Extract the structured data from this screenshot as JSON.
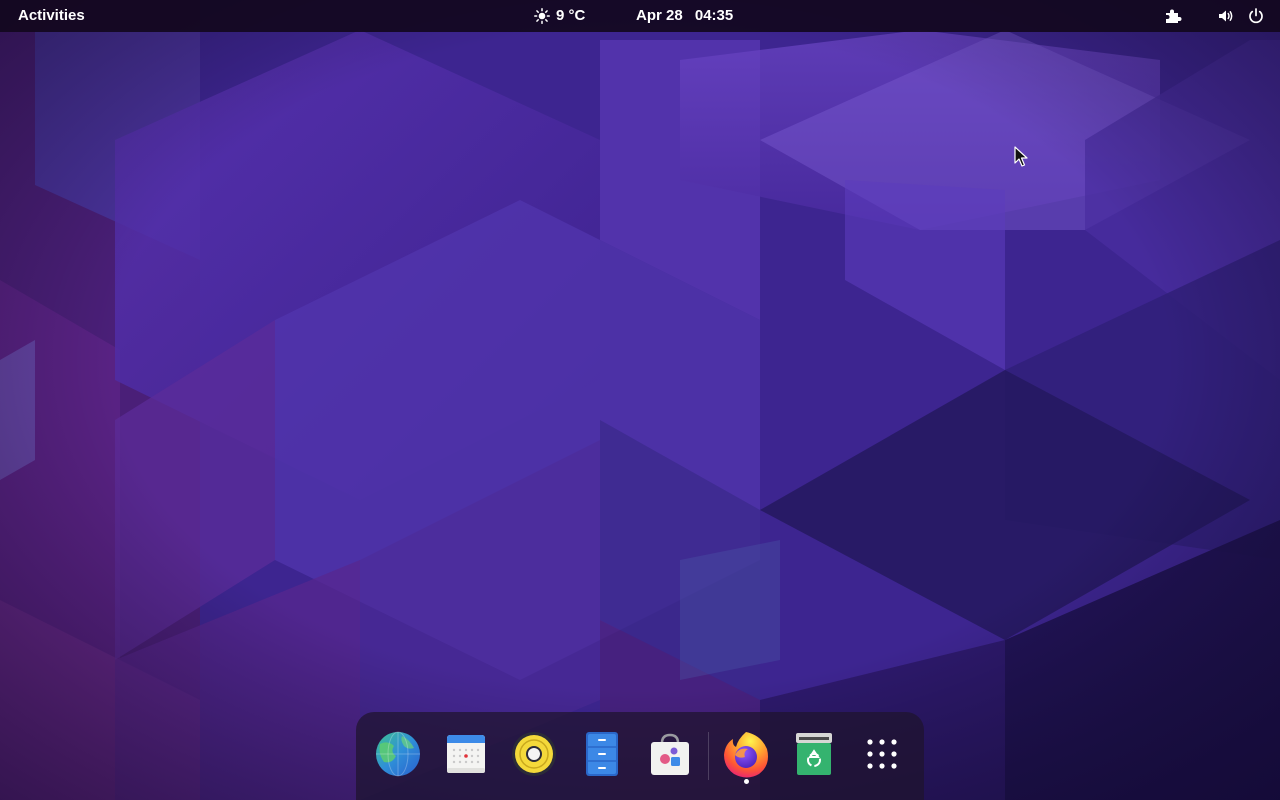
{
  "topbar": {
    "activities_label": "Activities",
    "weather": {
      "icon": "sun-icon",
      "temperature": "9 °C"
    },
    "clock": {
      "date": "Apr 28",
      "time": "04:35"
    },
    "tray": {
      "extensions_icon": "puzzle-icon",
      "volume_icon": "speaker-icon",
      "power_icon": "power-icon"
    }
  },
  "dock": {
    "apps": [
      {
        "id": "web-browser",
        "icon": "globe-icon"
      },
      {
        "id": "calendar",
        "icon": "calendar-icon"
      },
      {
        "id": "rhythmbox",
        "icon": "speaker-disc-icon"
      },
      {
        "id": "files",
        "icon": "file-cabinet-icon"
      },
      {
        "id": "software",
        "icon": "shopping-bag-icon"
      },
      {
        "id": "firefox",
        "icon": "firefox-icon",
        "running": true
      },
      {
        "id": "trash",
        "icon": "recycle-bin-icon"
      },
      {
        "id": "show-apps",
        "icon": "app-grid-icon"
      }
    ]
  },
  "colors": {
    "topbar_bg": "#12081e",
    "wallpaper_base": "#3a2384",
    "dock_bg": "#1e142d"
  }
}
